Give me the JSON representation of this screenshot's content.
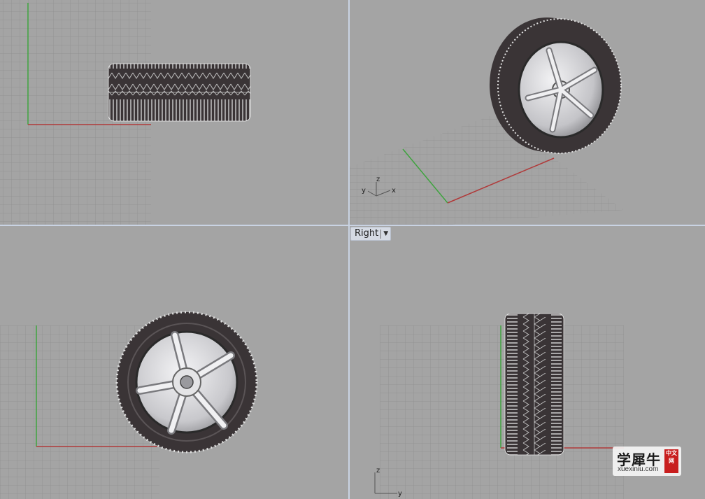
{
  "viewports": {
    "top": {
      "label": ""
    },
    "perspective": {
      "label": ""
    },
    "front": {
      "label": ""
    },
    "right": {
      "label": "Right"
    }
  },
  "axes": {
    "perspective": {
      "x": "x",
      "y": "y",
      "z": "z"
    },
    "right": {
      "y": "y",
      "z": "z"
    }
  },
  "watermark": {
    "main": "学犀牛",
    "sub": "xuexiniu.com",
    "seal": "中文网"
  },
  "colors": {
    "viewport_bg": "#a4a4a4",
    "grid": "#8f8f8f",
    "x_axis": "#b03a3a",
    "y_axis": "#3fa33f",
    "tire": "#3a3436",
    "rim": "#d8d8dc",
    "active_label_bg": "#d5dae3"
  }
}
